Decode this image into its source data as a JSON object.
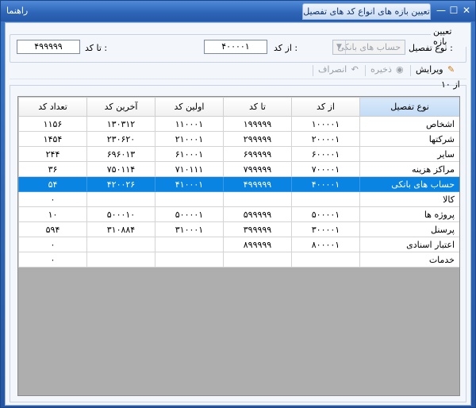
{
  "window": {
    "help_label": "راهنما",
    "title": "تعیین بازه های انواع کد های تفصیل",
    "min_glyph": "—",
    "max_glyph": "☐",
    "close_glyph": "✕"
  },
  "range_group": {
    "title": "تعیین بازه",
    "type_label": "نوع تفصیل :",
    "type_value": "حساب های بانکی",
    "from_label": "از کد :",
    "from_value": "۴۰۰۰۰۱",
    "to_label": "تا کد :",
    "to_value": "۴۹۹۹۹۹"
  },
  "toolbar": {
    "edit_label": "ویرایش",
    "save_label": "ذخیره",
    "cancel_label": "انصراف",
    "edit_icon": "pencil-icon",
    "save_icon": "save-icon",
    "cancel_icon": "undo-icon"
  },
  "list_group": {
    "title": "از ۱۰"
  },
  "table": {
    "headers": {
      "type": "نوع تفصیل",
      "from": "از کد",
      "to": "تا کد",
      "first": "اولین کد",
      "last": "آخرین کد",
      "count": "تعداد کد"
    },
    "rows": [
      {
        "type": "اشخاص",
        "from": "۱۰۰۰۰۱",
        "to": "۱۹۹۹۹۹",
        "first": "۱۱۰۰۰۱",
        "last": "۱۳۰۳۱۲",
        "count": "۱۱۵۶"
      },
      {
        "type": "شرکتها",
        "from": "۲۰۰۰۰۱",
        "to": "۲۹۹۹۹۹",
        "first": "۲۱۰۰۰۱",
        "last": "۲۳۰۶۲۰",
        "count": "۱۴۵۴"
      },
      {
        "type": "سایر",
        "from": "۶۰۰۰۰۱",
        "to": "۶۹۹۹۹۹",
        "first": "۶۱۰۰۰۱",
        "last": "۶۹۶۰۱۳",
        "count": "۲۴۴"
      },
      {
        "type": "مراکز هزینه",
        "from": "۷۰۰۰۰۱",
        "to": "۷۹۹۹۹۹",
        "first": "۷۱۰۱۱۱",
        "last": "۷۵۰۱۱۴",
        "count": "۳۶"
      },
      {
        "type": "حساب های بانکی",
        "from": "۴۰۰۰۰۱",
        "to": "۴۹۹۹۹۹",
        "first": "۴۱۰۰۰۱",
        "last": "۴۲۰۰۲۶",
        "count": "۵۴"
      },
      {
        "type": "کالا",
        "from": "",
        "to": "",
        "first": "",
        "last": "",
        "count": "۰"
      },
      {
        "type": "پروژه ها",
        "from": "۵۰۰۰۰۱",
        "to": "۵۹۹۹۹۹",
        "first": "۵۰۰۰۰۱",
        "last": "۵۰۰۰۱۰",
        "count": "۱۰"
      },
      {
        "type": "پرسنل",
        "from": "۳۰۰۰۰۱",
        "to": "۳۹۹۹۹۹",
        "first": "۳۱۰۰۰۱",
        "last": "۳۱۰۸۸۴",
        "count": "۵۹۴"
      },
      {
        "type": "اعتبار اسنادی",
        "from": "۸۰۰۰۰۱",
        "to": "۸۹۹۹۹۹",
        "first": "",
        "last": "",
        "count": "۰"
      },
      {
        "type": "خدمات",
        "from": "",
        "to": "",
        "first": "",
        "last": "",
        "count": "۰"
      }
    ]
  },
  "colors": {
    "selection": "#0a84e2",
    "title_bar": "#2f66b8"
  }
}
